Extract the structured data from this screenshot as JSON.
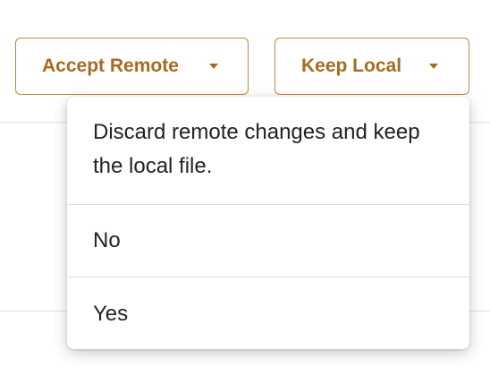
{
  "toolbar": {
    "accept_remote_label": "Accept Remote",
    "keep_local_label": "Keep Local"
  },
  "menu": {
    "description": "Discard remote changes and keep the local file.",
    "options": [
      "No",
      "Yes"
    ]
  },
  "colors": {
    "accent": "#a86a1f",
    "accent_border": "#c8873a",
    "text": "#222222",
    "divider": "#dedede"
  },
  "icons": {
    "dropdown": "caret-down-icon"
  }
}
